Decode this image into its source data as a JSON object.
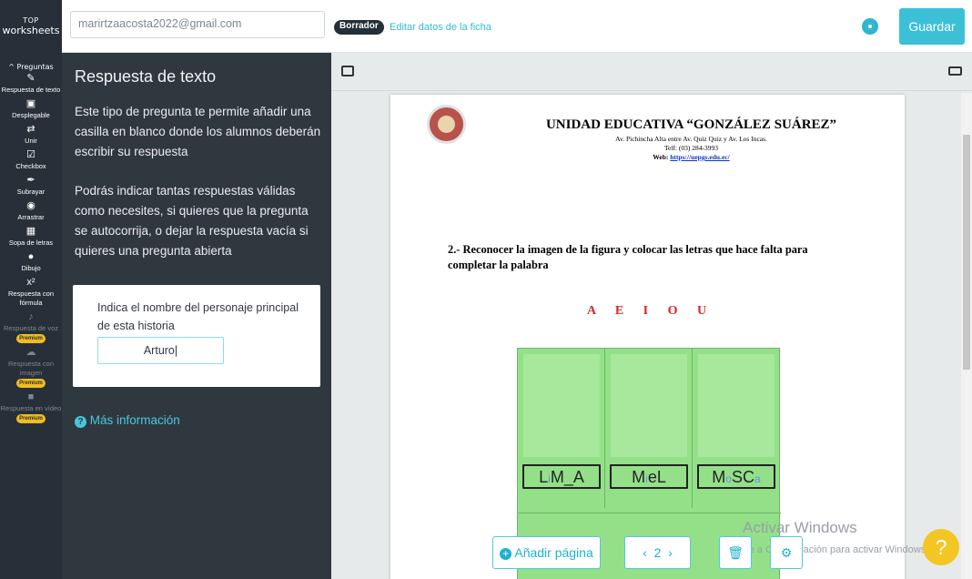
{
  "brand": {
    "line1": "TOP",
    "line2": "worksheets"
  },
  "header": {
    "email": "marirtzaacosta2022@gmail.com",
    "draft": "Borrador",
    "edit_link": "Editar datos de la ficha",
    "save": "Guardar"
  },
  "toolbar": {
    "collapse_label": "^ Preguntas",
    "items": [
      {
        "label": "Respuesta de texto",
        "icon": "edit-icon"
      },
      {
        "label": "Desplegable",
        "icon": "dropdown-icon"
      },
      {
        "label": "Unir",
        "icon": "swap-icon"
      },
      {
        "label": "Checkbox",
        "icon": "checkbox-icon"
      },
      {
        "label": "Subrayar",
        "icon": "marker-icon"
      },
      {
        "label": "Arrastrar",
        "icon": "drag-icon"
      },
      {
        "label": "Sopa de letras",
        "icon": "grid-icon"
      },
      {
        "label": "Dibujo",
        "icon": "palette-icon"
      },
      {
        "label": "Respuesta con fórmula",
        "icon": "formula-icon"
      },
      {
        "label": "Respuesta de voz",
        "icon": "microphone-icon"
      },
      {
        "label": "Respuesta con imagen",
        "icon": "camera-icon"
      },
      {
        "label": "Respuesta en vídeo",
        "icon": "video-icon"
      }
    ],
    "premium": "Premium"
  },
  "panel": {
    "title": "Respuesta de texto",
    "desc1": "Este tipo de pregunta te permite añadir una casilla en blanco donde los alumnos deberán escribir su respuesta",
    "desc2": "Podrás indicar tantas respuestas válidas como necesites, si quieres que la pregunta se autocorrija, o dejar la respuesta vacía si quieres una pregunta abierta",
    "card_question": "Indica el nombre del personaje principal de esta historia",
    "card_answer": "Arturo|",
    "more_info": "Más información"
  },
  "sheet": {
    "school": "UNIDAD EDUCATIVA “GONZÁLEZ SUÁREZ”",
    "address": "Av. Pichincha Alta entre Av. Quiz Quiz y Av. Los Incas.",
    "phone": "Telf: (03) 284-3993",
    "web_prefix": "Web: ",
    "web_url": "https://uepgs.edu.ec/",
    "instruction": "2.- Reconocer la imagen de la figura y colocar las letras que hace falta para completar la palabra",
    "vowels": "A E I O U",
    "cells": [
      {
        "pre": "L",
        "fill": "i",
        "post": "M_A"
      },
      {
        "pre": "M",
        "fill": "i",
        "post": "eL"
      },
      {
        "pre": "M",
        "fill": "o",
        "post": "SC",
        "tail": "a"
      }
    ]
  },
  "bottom": {
    "add_page": "Añadir página",
    "page": "2"
  },
  "watermark": {
    "line1": "Activar Windows",
    "line2": "Ve a Configuración para activar Windows."
  }
}
